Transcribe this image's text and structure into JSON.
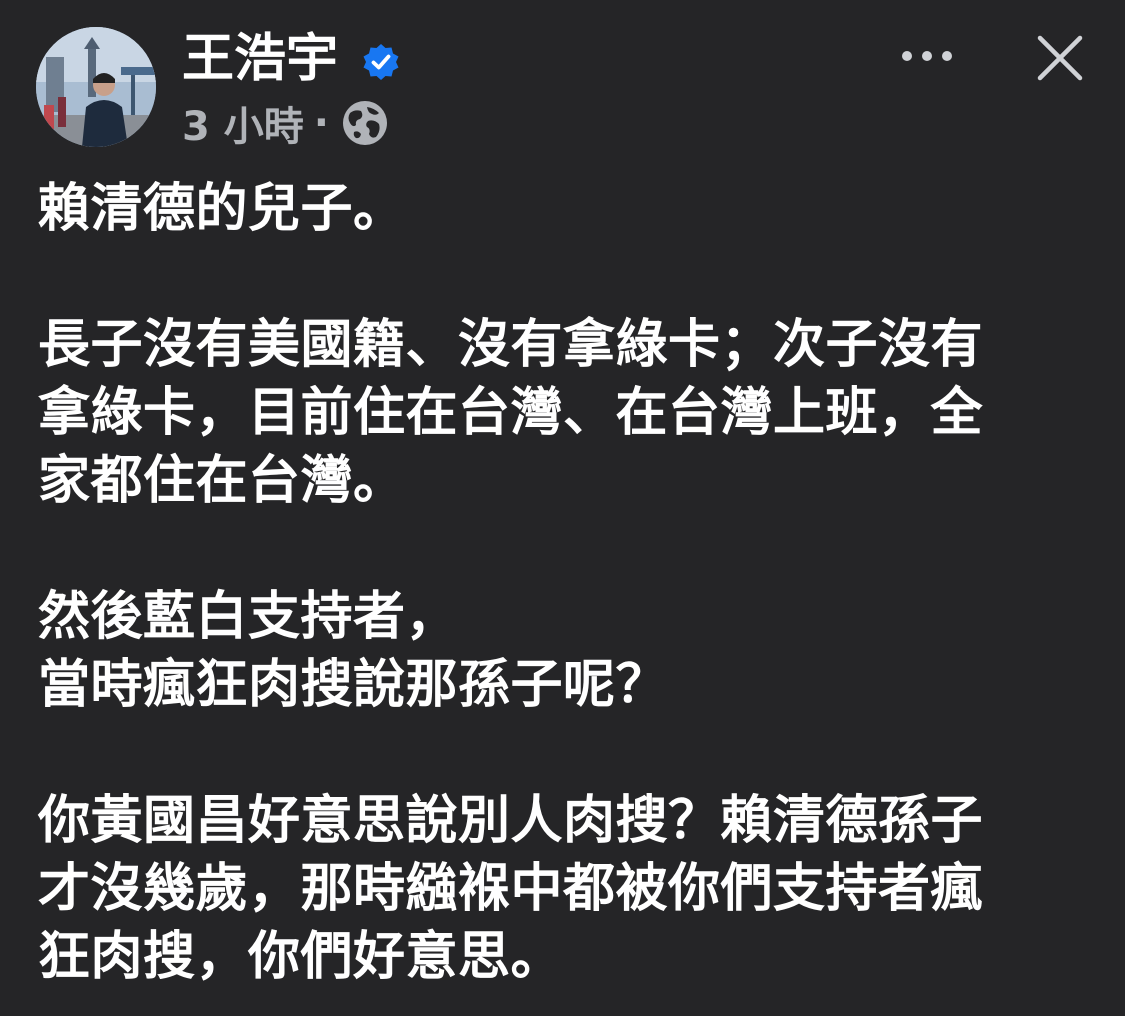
{
  "post": {
    "author_name": "王浩宇",
    "verified_icon": "verified-badge-icon",
    "time": "3 小時",
    "separator": "·",
    "audience_icon": "globe-icon",
    "paragraphs": [
      "賴清德的兒子。",
      "長子沒有美國籍、沒有拿綠卡；次子沒有\n拿綠卡，目前住在台灣、在台灣上班，全\n家都住在台灣。",
      "然後藍白支持者，\n當時瘋狂肉搜說那孫子呢？",
      "你黃國昌好意思說別人肉搜？賴清德孫子\n才沒幾歲，那時繈褓中都被你們支持者瘋\n狂肉搜，你們好意思。"
    ]
  },
  "header": {
    "more_icon": "more-options-icon",
    "close_icon": "close-icon"
  },
  "colors": {
    "background": "#252527",
    "text": "#ffffff",
    "secondary_text": "#b0b3b8",
    "verified_blue": "#1877f2"
  }
}
